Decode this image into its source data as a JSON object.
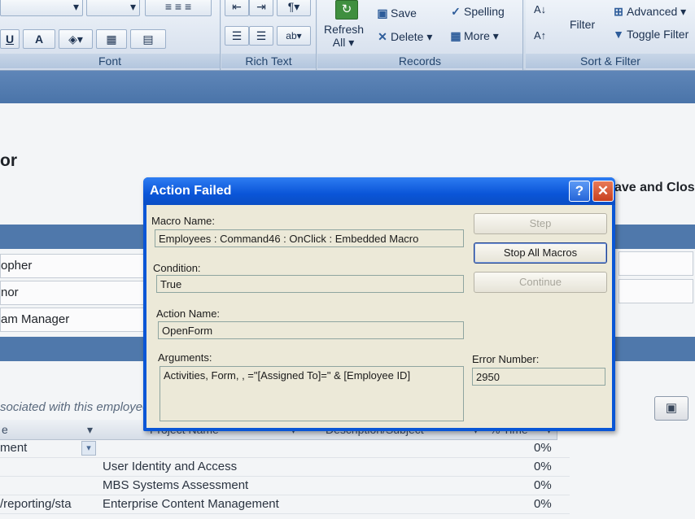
{
  "ribbon": {
    "groups": {
      "font": "Font",
      "rich_text": "Rich Text",
      "records": "Records",
      "sort_filter": "Sort & Filter"
    },
    "font_controls": {
      "underline": "U",
      "font_color": "A",
      "fill": "▾"
    },
    "records": {
      "refresh_line1": "Refresh",
      "refresh_line2": "All ▾",
      "save": "Save",
      "delete": "Delete ▾",
      "spelling": "Spelling",
      "more": "More ▾"
    },
    "sort_filter": {
      "filter": "Filter",
      "advanced": "Advanced ▾",
      "toggle_filter": "Toggle Filter"
    }
  },
  "form": {
    "title_partial": "or",
    "save_close_partial": "ave and Clos",
    "fields": [
      "opher",
      "nor",
      "am Manager"
    ],
    "associated_text": "sociated with this employee",
    "sheet": {
      "headers": [
        "e",
        "Project Name",
        "Description/Subject",
        "% Time"
      ],
      "rows": [
        {
          "type": "ment",
          "project": "",
          "pct": "0%"
        },
        {
          "type": "",
          "project": "User Identity and Access",
          "pct": "0%"
        },
        {
          "type": "",
          "project": "MBS Systems Assessment",
          "pct": "0%"
        },
        {
          "type": "/reporting/sta",
          "project": "Enterprise Content Management",
          "pct": "0%"
        }
      ]
    }
  },
  "dialog": {
    "title": "Action Failed",
    "help": "?",
    "close": "✕",
    "macro_name_label": "Macro Name:",
    "macro_name": "Employees : Command46 : OnClick : Embedded Macro",
    "condition_label": "Condition:",
    "condition": "True",
    "action_name_label": "Action Name:",
    "action_name": "OpenForm",
    "arguments_label": "Arguments:",
    "arguments": "Activities, Form, , =\"[Assigned To]=\" & [Employee ID]",
    "error_number_label": "Error Number:",
    "error_number": "2950",
    "buttons": {
      "step": "Step",
      "stop_all": "Stop All Macros",
      "continue": "Continue"
    }
  }
}
